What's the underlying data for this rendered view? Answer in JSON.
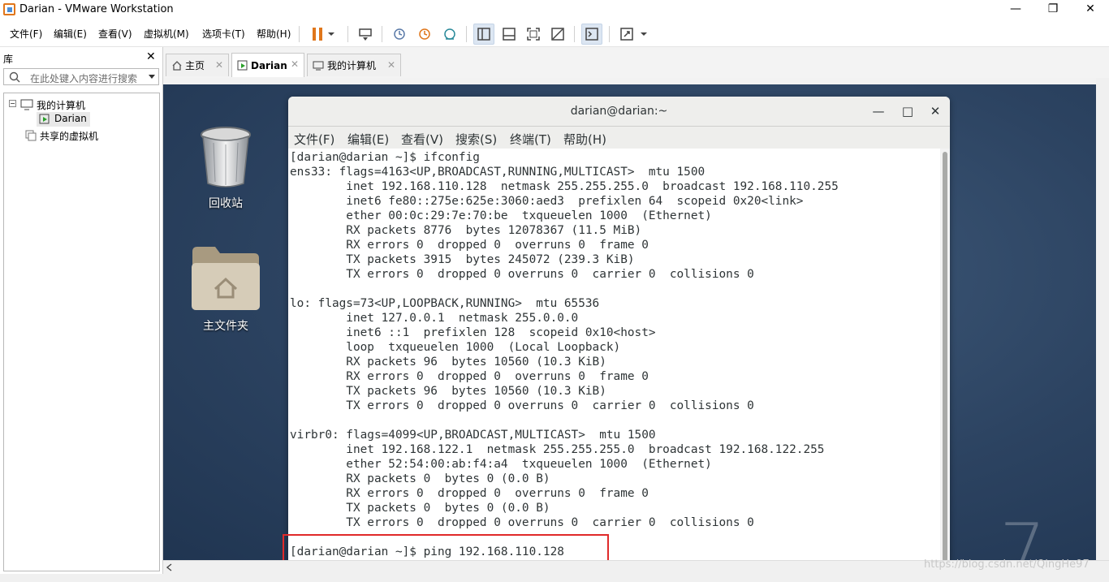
{
  "window": {
    "title": "Darian - VMware Workstation",
    "controls": {
      "minimize": "—",
      "restore": "❐",
      "close": "✕"
    }
  },
  "menubar": {
    "items": [
      "文件(F)",
      "编辑(E)",
      "查看(V)",
      "虚拟机(M)",
      "选项卡(T)",
      "帮助(H)"
    ]
  },
  "library": {
    "title": "库",
    "close": "✕",
    "search_placeholder": "在此处键入内容进行搜索",
    "tree": {
      "root": "我的计算机",
      "vm": "Darian",
      "shared": "共享的虚拟机"
    }
  },
  "tabs": [
    {
      "label": "主页",
      "close": "✕"
    },
    {
      "label": "Darian",
      "close": "✕"
    },
    {
      "label": "我的计算机",
      "close": "✕"
    }
  ],
  "desktop": {
    "icons": [
      {
        "label": "回收站"
      },
      {
        "label": "主文件夹"
      }
    ],
    "watermark_digit": "7"
  },
  "terminal": {
    "title": "darian@darian:~",
    "controls": {
      "minimize": "—",
      "maximize": "□",
      "close": "✕"
    },
    "menu": [
      "文件(F)",
      "编辑(E)",
      "查看(V)",
      "搜索(S)",
      "终端(T)",
      "帮助(H)"
    ],
    "lines": [
      "[darian@darian ~]$ ifconfig",
      "ens33: flags=4163<UP,BROADCAST,RUNNING,MULTICAST>  mtu 1500",
      "        inet 192.168.110.128  netmask 255.255.255.0  broadcast 192.168.110.255",
      "        inet6 fe80::275e:625e:3060:aed3  prefixlen 64  scopeid 0x20<link>",
      "        ether 00:0c:29:7e:70:be  txqueuelen 1000  (Ethernet)",
      "        RX packets 8776  bytes 12078367 (11.5 MiB)",
      "        RX errors 0  dropped 0  overruns 0  frame 0",
      "        TX packets 3915  bytes 245072 (239.3 KiB)",
      "        TX errors 0  dropped 0 overruns 0  carrier 0  collisions 0",
      "",
      "lo: flags=73<UP,LOOPBACK,RUNNING>  mtu 65536",
      "        inet 127.0.0.1  netmask 255.0.0.0",
      "        inet6 ::1  prefixlen 128  scopeid 0x10<host>",
      "        loop  txqueuelen 1000  (Local Loopback)",
      "        RX packets 96  bytes 10560 (10.3 KiB)",
      "        RX errors 0  dropped 0  overruns 0  frame 0",
      "        TX packets 96  bytes 10560 (10.3 KiB)",
      "        TX errors 0  dropped 0 overruns 0  carrier 0  collisions 0",
      "",
      "virbr0: flags=4099<UP,BROADCAST,MULTICAST>  mtu 1500",
      "        inet 192.168.122.1  netmask 255.255.255.0  broadcast 192.168.122.255",
      "        ether 52:54:00:ab:f4:a4  txqueuelen 1000  (Ethernet)",
      "        RX packets 0  bytes 0 (0.0 B)",
      "        RX errors 0  dropped 0  overruns 0  frame 0",
      "        TX packets 0  bytes 0 (0.0 B)",
      "        TX errors 0  dropped 0 overruns 0  carrier 0  collisions 0",
      "",
      "[darian@darian ~]$ ping 192.168.110.128"
    ]
  },
  "watermark": "https://blog.csdn.net/QingHe97",
  "colors": {
    "highlight": "#e02a2a",
    "accent_orange": "#e0761b"
  }
}
